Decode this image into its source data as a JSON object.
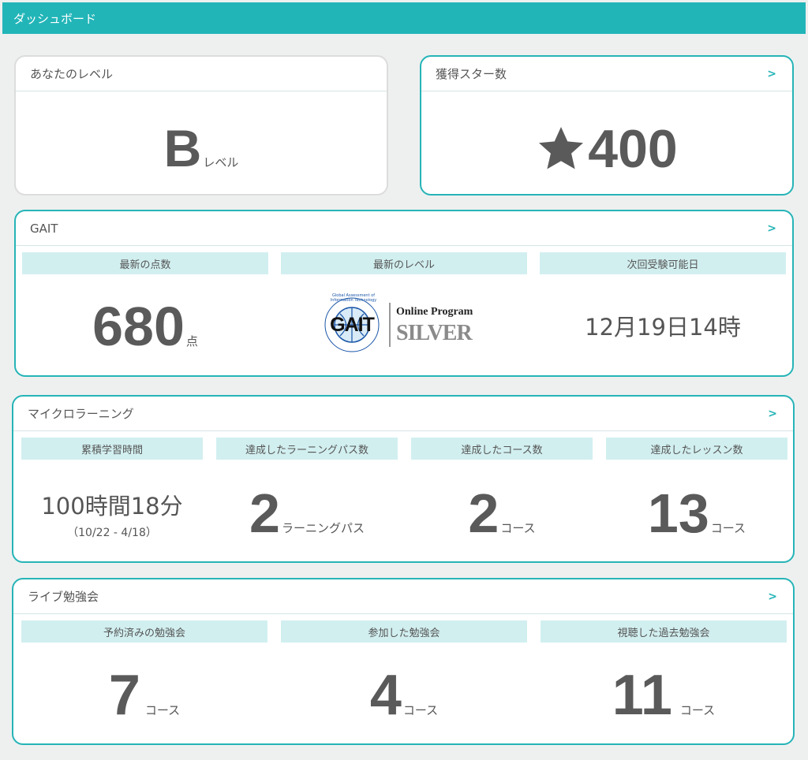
{
  "header": {
    "title": "ダッシュボード"
  },
  "level_card": {
    "title": "あなたのレベル",
    "value": "B",
    "unit": "レベル"
  },
  "star_card": {
    "title": "獲得スター数",
    "value": "400",
    "chevron": ">"
  },
  "gait": {
    "title": "GAIT",
    "chevron": ">",
    "cols": [
      {
        "label": "最新の点数",
        "value": "680",
        "unit": "点"
      },
      {
        "label": "最新のレベル",
        "logo_ring_text": "Global Assessment of Information Technology",
        "logo_brand": "GAIT",
        "logo_program": "Online Program",
        "logo_level": "SILVER"
      },
      {
        "label": "次回受験可能日",
        "value": "12月19日14時"
      }
    ]
  },
  "micro": {
    "title": "マイクロラーニング",
    "chevron": ">",
    "cols": [
      {
        "label": "累積学習時間",
        "value": "100時間18分",
        "range": "（10/22 - 4/18）"
      },
      {
        "label": "達成したラーニングパス数",
        "value": "2",
        "unit": "ラーニングパス"
      },
      {
        "label": "達成したコース数",
        "value": "2",
        "unit": "コース"
      },
      {
        "label": "達成したレッスン数",
        "value": "13",
        "unit": "コース"
      }
    ]
  },
  "live": {
    "title": "ライブ勉強会",
    "chevron": ">",
    "cols": [
      {
        "label": "予約済みの勉強会",
        "value": "7",
        "unit": "コース"
      },
      {
        "label": "参加した勉強会",
        "value": "4",
        "unit": "コース"
      },
      {
        "label": "視聴した過去勉強会",
        "value": "11",
        "unit": "コース"
      }
    ]
  },
  "icons": {
    "star": "star-icon",
    "chevron": "chevron-right-icon"
  },
  "colors": {
    "accent": "#22b5b8",
    "sub_bg": "#d2eff0",
    "text": "#555555"
  }
}
